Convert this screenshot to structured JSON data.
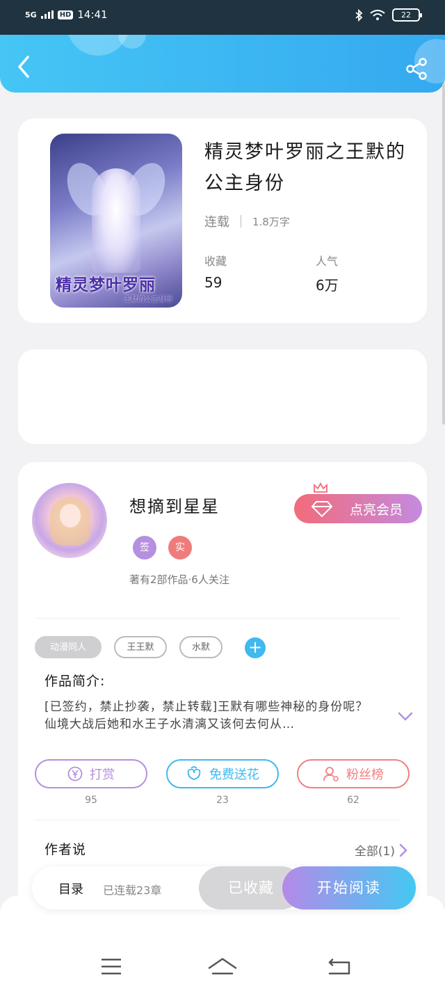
{
  "status_bar": {
    "signal": "5G",
    "hd": "HD",
    "time": "14:41",
    "battery": "22"
  },
  "book": {
    "title": "精灵梦叶罗丽之王默的公主身份",
    "status": "连载",
    "word_count": "1.8万字",
    "collect_label": "收藏",
    "collect_value": "59",
    "popularity_label": "人气",
    "popularity_value": "6万",
    "cover_title": "精灵梦叶罗丽",
    "cover_subtitle": "王默的公主身份"
  },
  "author": {
    "name": "想摘到星星",
    "badge_sign": "签",
    "badge_real": "实",
    "info": "著有2部作品·6人关注",
    "vip_button": "点亮会员"
  },
  "tags": [
    "动漫同人",
    "王王默",
    "水默"
  ],
  "intro": {
    "heading": "作品简介:",
    "text": "[已签约，禁止抄袭，禁止转载]王默有哪些神秘的身份呢？仙境大战后她和水王子水清漓又该何去何从…"
  },
  "actions": [
    {
      "label": "打赏",
      "count": "95",
      "color": "#b58fe0"
    },
    {
      "label": "免费送花",
      "count": "23",
      "color": "#3fb9ee"
    },
    {
      "label": "粉丝榜",
      "count": "62",
      "color": "#f08080"
    }
  ],
  "author_says": {
    "heading": "作者说",
    "all_link": "全部(1)"
  },
  "read_bar": {
    "toc": "目录",
    "serial": "已连载23章",
    "favorited": "已收藏",
    "start": "开始阅读"
  },
  "colors": {
    "accent_blue": "#3fb9ee",
    "accent_purple": "#b58fe0",
    "accent_pink": "#f08080"
  }
}
